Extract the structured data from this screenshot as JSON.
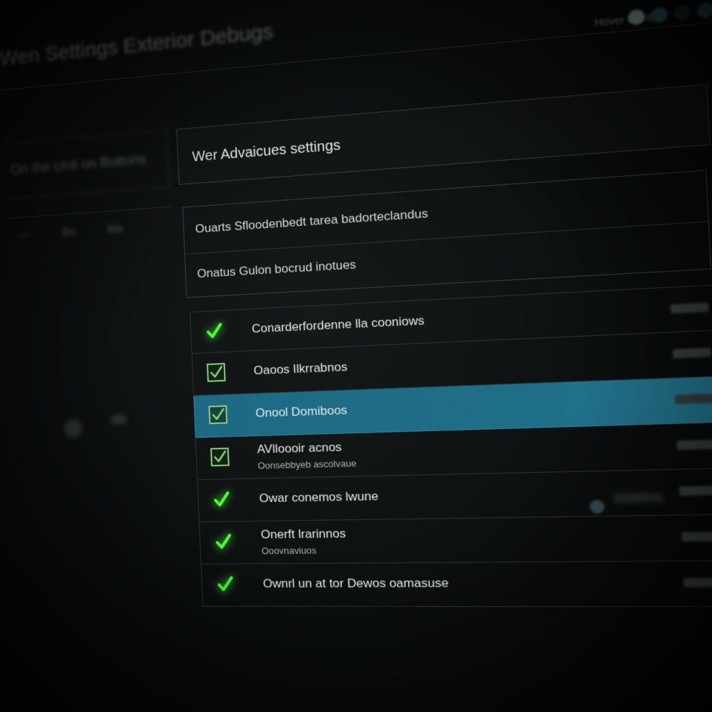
{
  "window": {
    "title": "Wen Settings Exterior Debugs",
    "top_status": "Hover Control"
  },
  "sidebar": {
    "header": "On the Unit on Buttons",
    "row": [
      "—",
      "Bo",
      "Me"
    ]
  },
  "panel": {
    "title": "Wer Advaicues settings",
    "info_lines": [
      "Ouarts Sfloodenbedt tarea badorteclandus",
      "Onatus  Gulon bocrud inotues"
    ]
  },
  "options": [
    {
      "label": "Conarderfordenne lla cooniows",
      "sub": "",
      "state": "checked",
      "style": "tick",
      "selected": false
    },
    {
      "label": "Oaoos Ilkrrabnos",
      "sub": "",
      "state": "checked",
      "style": "box",
      "selected": false
    },
    {
      "label": "Onool Domiboos",
      "sub": "",
      "state": "checked",
      "style": "box",
      "selected": true
    },
    {
      "label": "AVlloooir acnos",
      "sub": "Oonsebbyeb ascolvaue",
      "state": "checked",
      "style": "box",
      "selected": false
    },
    {
      "label": "Owar conemos lwune",
      "sub": "",
      "state": "checked",
      "style": "tick",
      "selected": false
    },
    {
      "label": "Onerft lrarinnos",
      "sub": "Ooovnaviuos",
      "state": "checked",
      "style": "tick",
      "selected": false
    },
    {
      "label": "Ownrl un at tor Dewos oamasuse",
      "sub": "",
      "state": "checked",
      "style": "tick",
      "selected": false
    }
  ],
  "colors": {
    "accent_selected": "#1f6e88",
    "check_green": "#4bff3c",
    "background": "#0c0f0f"
  },
  "icons": {
    "tick": "check-icon",
    "box": "checkbox-checked-icon"
  }
}
